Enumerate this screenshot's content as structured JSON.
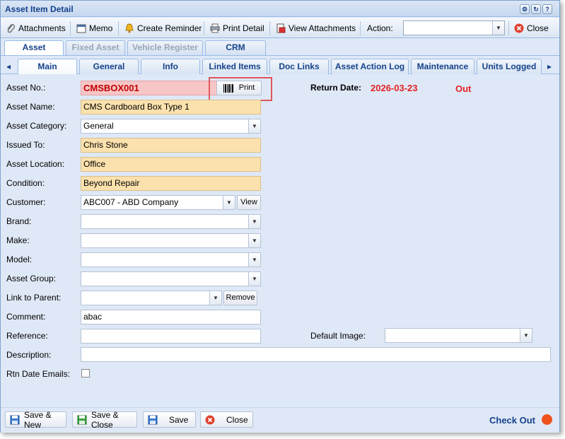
{
  "window": {
    "title": "Asset Item Detail"
  },
  "toolbar": {
    "attachments": "Attachments",
    "memo": "Memo",
    "create_reminder": "Create Reminder",
    "print_detail": "Print Detail",
    "view_attachments": "View Attachments",
    "action_label": "Action:",
    "action_value": "",
    "close": "Close"
  },
  "outer_tabs": [
    "Asset",
    "Fixed Asset",
    "Vehicle Register",
    "CRM"
  ],
  "inner_tabs": [
    "Main",
    "General",
    "Info",
    "Linked Items",
    "Doc Links",
    "Asset Action Log",
    "Maintenance",
    "Units Logged"
  ],
  "form": {
    "asset_no": {
      "label": "Asset No.:",
      "value": "CMSBOX001"
    },
    "print_button": "Print",
    "return_date": {
      "label": "Return Date:",
      "value": "2026-03-23",
      "status": "Out"
    },
    "asset_name": {
      "label": "Asset Name:",
      "value": "CMS Cardboard Box Type 1"
    },
    "asset_category": {
      "label": "Asset Category:",
      "value": "General"
    },
    "issued_to": {
      "label": "Issued To:",
      "value": "Chris Stone"
    },
    "asset_location": {
      "label": "Asset Location:",
      "value": "Office"
    },
    "condition": {
      "label": "Condition:",
      "value": "Beyond Repair"
    },
    "customer": {
      "label": "Customer:",
      "value": "ABC007 - ABD  Company",
      "view": "View"
    },
    "brand": {
      "label": "Brand:",
      "value": ""
    },
    "make": {
      "label": "Make:",
      "value": ""
    },
    "model": {
      "label": "Model:",
      "value": ""
    },
    "asset_group": {
      "label": "Asset Group:",
      "value": ""
    },
    "link_to_parent": {
      "label": "Link to Parent:",
      "value": "",
      "remove": "Remove"
    },
    "comment": {
      "label": "Comment:",
      "value": "abac"
    },
    "reference": {
      "label": "Reference:",
      "value": ""
    },
    "default_image": {
      "label": "Default Image:",
      "value": ""
    },
    "description": {
      "label": "Description:",
      "value": ""
    },
    "rtn_date_emails": {
      "label": "Rtn Date Emails:",
      "checked": false
    }
  },
  "footer": {
    "save_new": "Save & New",
    "save_close": "Save & Close",
    "save": "Save",
    "close": "Close",
    "check_out": "Check Out"
  },
  "colors": {
    "accent": "#15428b",
    "required_bg": "#fbe1ad",
    "asset_no_bg": "#f8c6c6",
    "status_red": "#e52222",
    "highlight": "#e0565e"
  }
}
